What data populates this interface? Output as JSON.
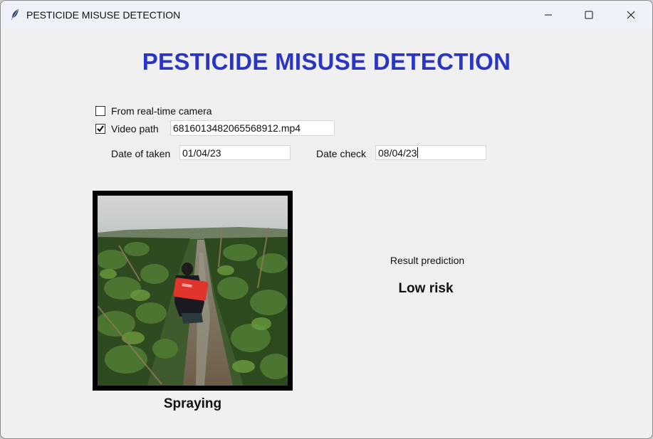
{
  "window": {
    "title": "PESTICIDE MISUSE DETECTION",
    "icon": "feather-icon"
  },
  "heading": "PESTICIDE MISUSE DETECTION",
  "heading_color": "#2b35c4",
  "source": {
    "camera_label": "From real-time camera",
    "camera_checked": false,
    "video_label": "Video path",
    "video_checked": true,
    "video_path": "6816013482065568912.mp4"
  },
  "dates": {
    "taken_label": "Date of taken",
    "taken_value": "01/04/23",
    "check_label": "Date check",
    "check_value": "08/04/23"
  },
  "frame": {
    "caption": "Spraying"
  },
  "result": {
    "label": "Result prediction",
    "value": "Low risk"
  }
}
